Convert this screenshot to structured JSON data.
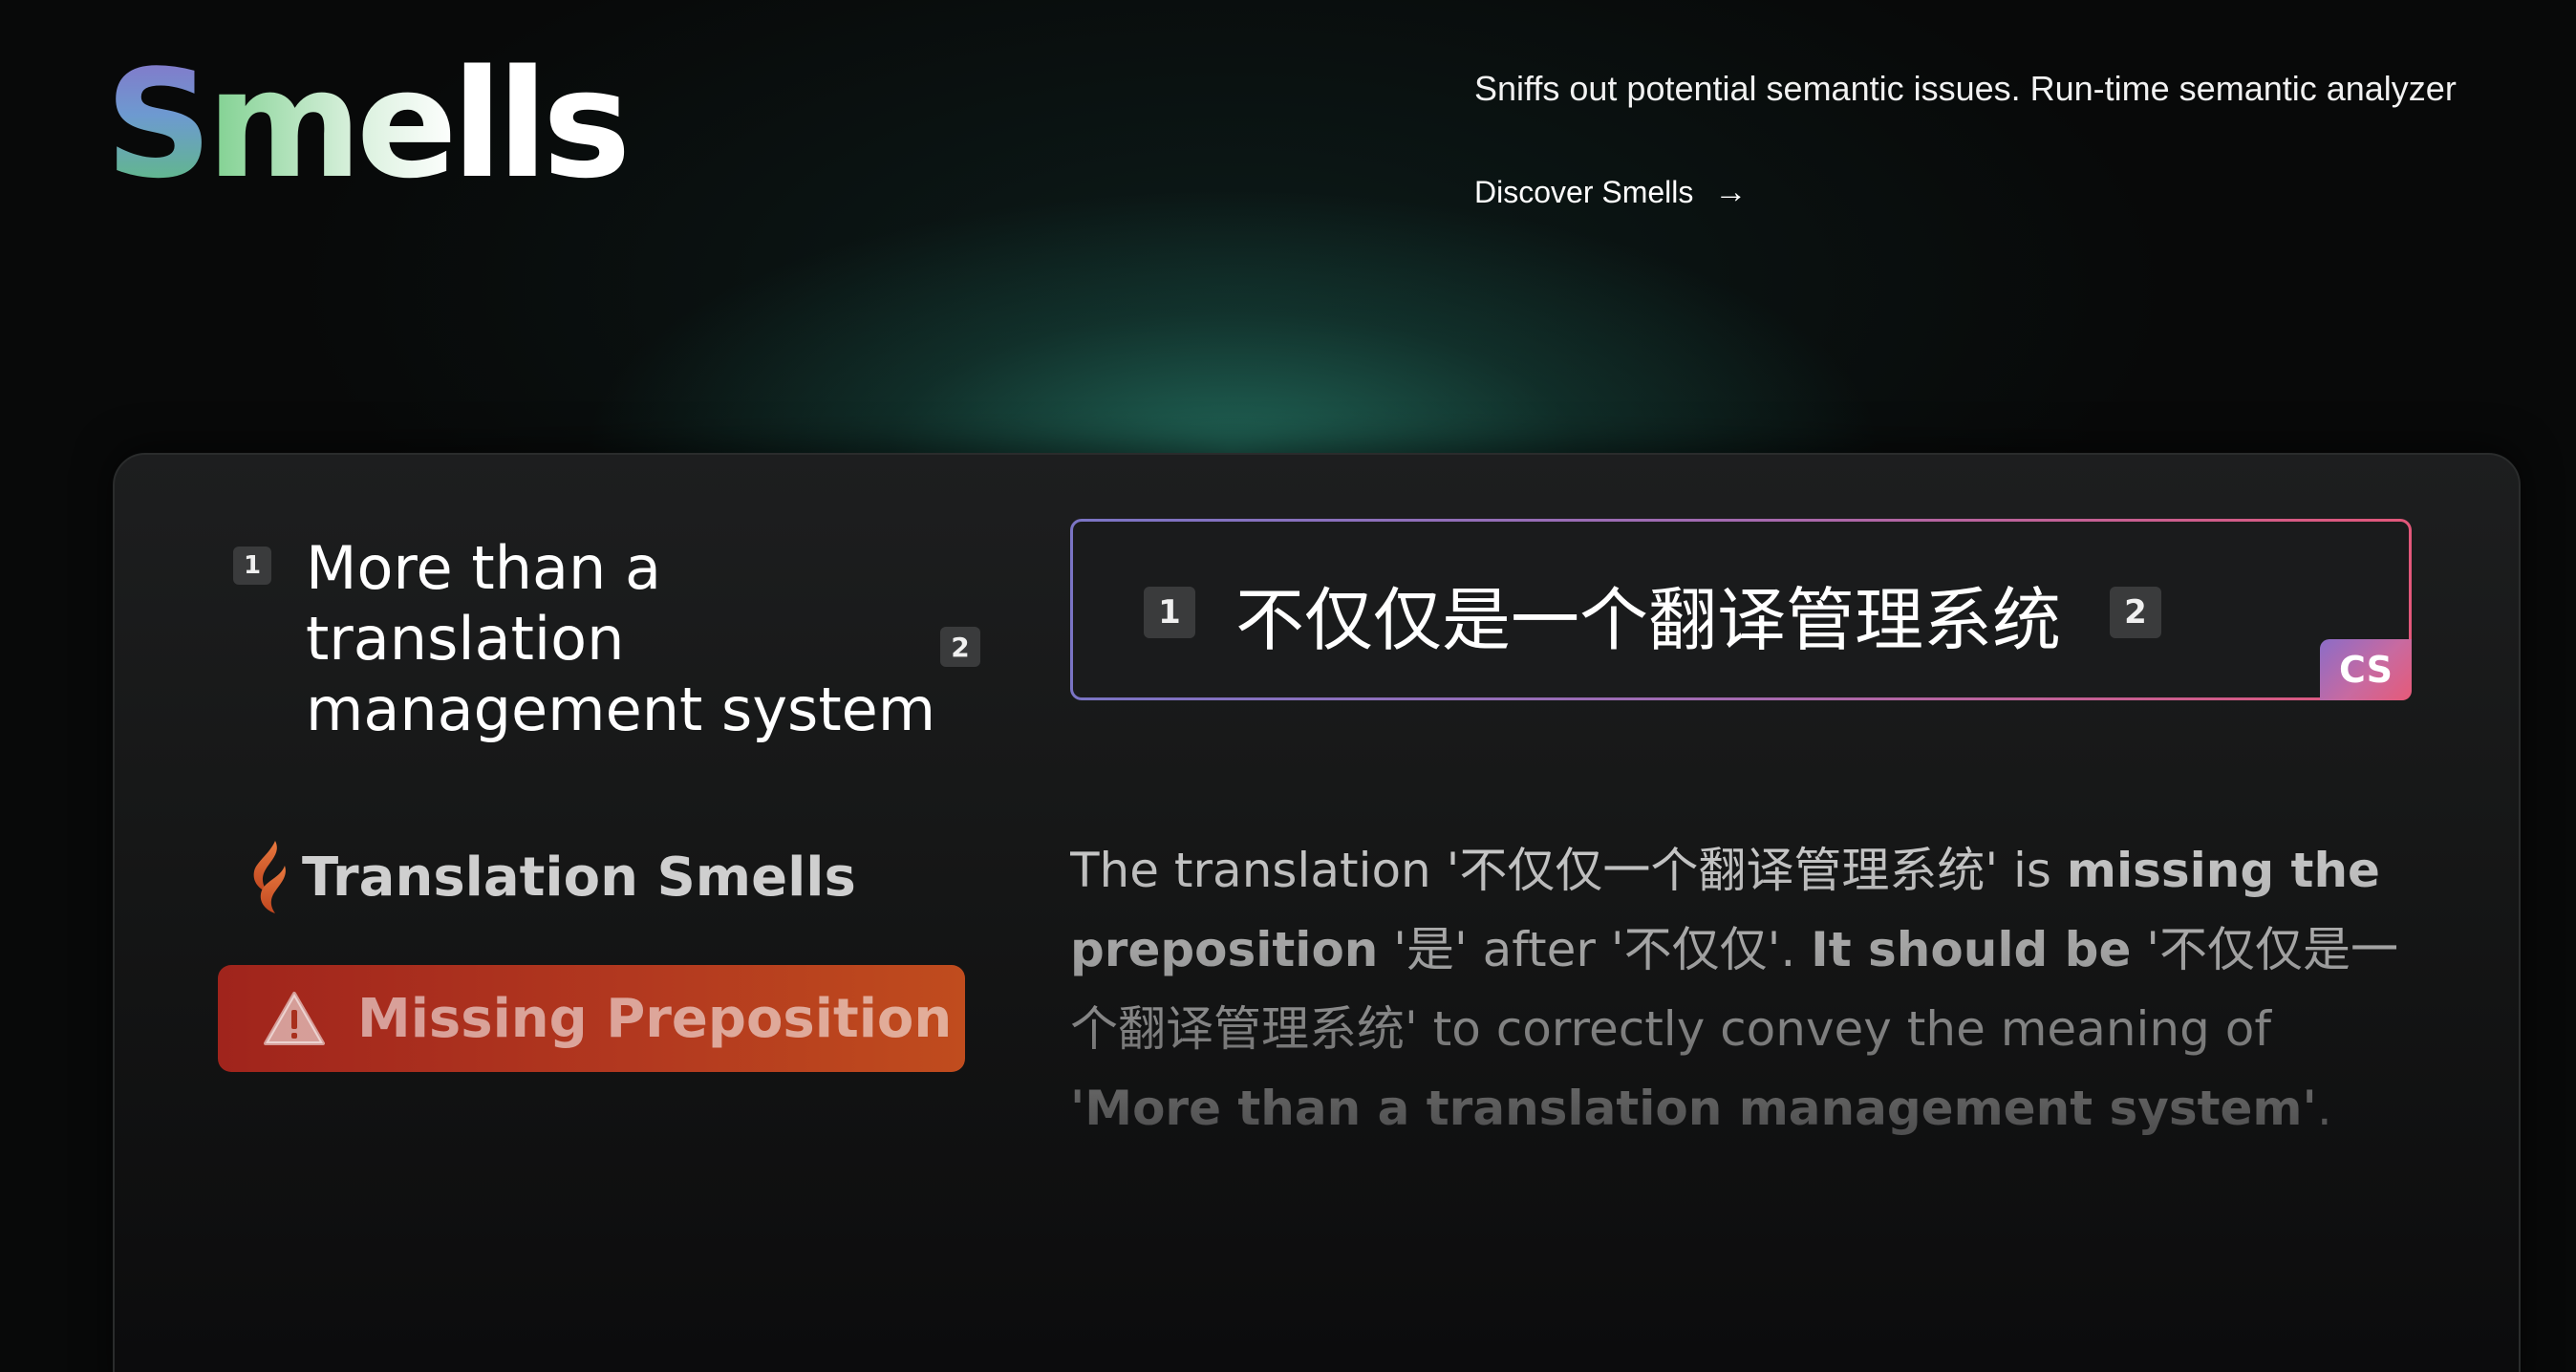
{
  "header": {
    "logo_first": "S",
    "logo_rest": "mells",
    "tagline": "Sniffs out potential semantic issues. Run-time semantic analyzer",
    "discover_label": "Discover Smells",
    "discover_arrow": "→"
  },
  "source": {
    "badge_start": "1",
    "text": "More than a translation management system",
    "badge_end": "2"
  },
  "target": {
    "badge_start": "1",
    "text": "不仅仅是一个翻译管理系统",
    "badge_end": "2",
    "language_tag": "CS"
  },
  "smells": {
    "title": "Translation Smells",
    "issue_label": "Missing Preposition",
    "icons": [
      "flame-icon",
      "warning-icon"
    ],
    "colors": {
      "issue_bg": "#a0241c",
      "issue_bg_end": "#c04c1e",
      "flame": "#e06a38"
    }
  },
  "explanation": {
    "p1": "The translation '不仅仅一个翻译管理系统' is ",
    "b1": "missing the preposition",
    "p2": " '是' after '不仅仅'. ",
    "b2": "It should be",
    "p3": " '不仅仅是一个翻译管理系统' to correctly convey the meaning of ",
    "b3": "'More than a translation management system'",
    "p4": "."
  }
}
